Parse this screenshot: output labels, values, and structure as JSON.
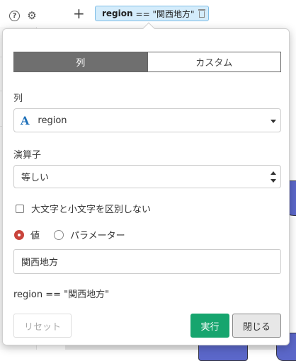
{
  "toolbar": {
    "help_icon": "?",
    "settings_icon": "⚙",
    "add_icon": "+"
  },
  "filter_chip": {
    "column": "region",
    "operator_value": "== \"関西地方\""
  },
  "popover": {
    "segments": {
      "column": "列",
      "custom": "カスタム"
    },
    "column_label": "列",
    "column_type_icon": "A",
    "column_value": "region",
    "operator_label": "演算子",
    "operator_value": "等しい",
    "case_insensitive_label": "大文字と小文字を区別しない",
    "value_radio_label": "値",
    "parameter_radio_label": "パラメーター",
    "value_input": "関西地方",
    "expression_preview": "region == \"関西地方\"",
    "buttons": {
      "reset": "リセット",
      "run": "実行",
      "close": "閉じる"
    }
  },
  "colors": {
    "accent_green": "#16a56e",
    "radio_red": "#c9443c",
    "chip_blue": "#d4ecfb",
    "segment_active": "#6f6f6f"
  }
}
